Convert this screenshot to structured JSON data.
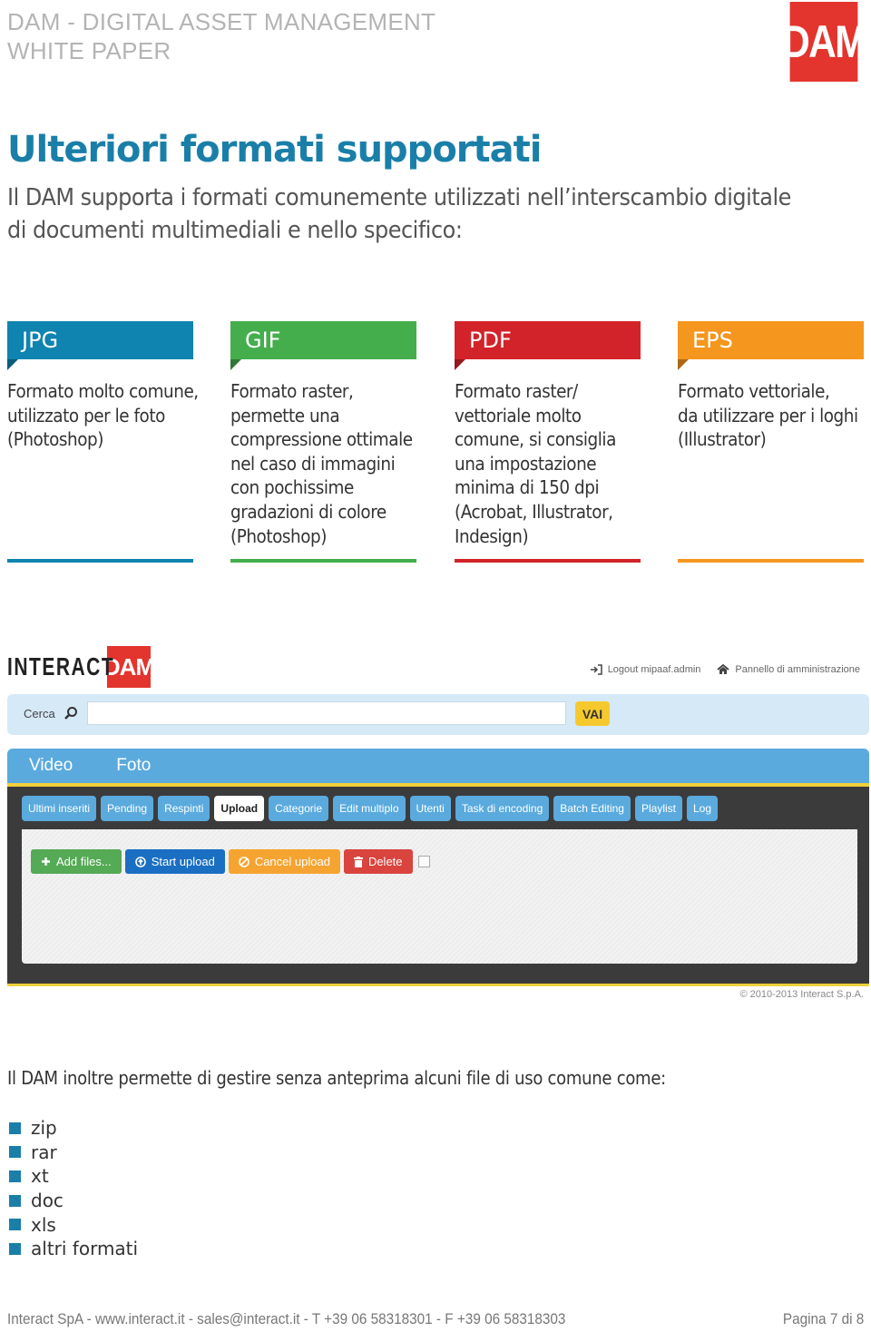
{
  "header": {
    "title_line1": "DAM - DIGITAL ASSET MANAGEMENT",
    "title_line2": "WHITE PAPER",
    "logo": "DAM"
  },
  "section": {
    "title": "Ulteriori formati supportati",
    "intro_lines": [
      "Il DAM supporta i formati comunemente utilizzati nell’interscambio digitale",
      "di documenti multimediali e nello specifico:"
    ]
  },
  "formats": [
    {
      "label": "JPG",
      "color": "#0f84b0",
      "lines": [
        "Formato molto comune,",
        "utilizzato per le foto",
        "(Photoshop)"
      ]
    },
    {
      "label": "GIF",
      "color": "#44ae4c",
      "lines": [
        "Formato raster,",
        "permette una",
        "compressione ottimale",
        "nel caso di immagini",
        "con pochissime",
        "gradazioni di colore",
        "(Photoshop)"
      ]
    },
    {
      "label": "PDF",
      "color": "#d3232a",
      "lines": [
        "Formato raster/",
        "vettoriale molto",
        "comune, si consiglia",
        "una impostazione",
        "minima di 150 dpi",
        "(Acrobat, Illustrator,",
        "Indesign)"
      ]
    },
    {
      "label": "EPS",
      "color": "#f5961e",
      "lines": [
        "Formato vettoriale,",
        "da utilizzare per i loghi",
        "(Illustrator)"
      ]
    }
  ],
  "screenshot": {
    "logo_text": "INTERACT",
    "logo_badge": "DAM",
    "logout_label": "Logout mipaaf.admin",
    "admin_label": "Pannello di amministrazione",
    "search_label": "Cerca",
    "search_value": "",
    "search_button": "VAI",
    "main_tabs": [
      "Video",
      "Foto"
    ],
    "sub_tabs": [
      "Ultimi inseriti",
      "Pending",
      "Respinti",
      "Upload",
      "Categorie",
      "Edit multiplo",
      "Utenti",
      "Task di encoding",
      "Batch Editing",
      "Playlist",
      "Log"
    ],
    "active_sub_tab": "Upload",
    "buttons": {
      "add_files": "Add files...",
      "start_upload": "Start upload",
      "cancel_upload": "Cancel upload",
      "delete": "Delete"
    },
    "copyright": "© 2010-2013 Interact S.p.A."
  },
  "other_files": {
    "intro": "Il DAM inoltre permette di gestire senza anteprima alcuni file di uso comune come:",
    "items": [
      "zip",
      "rar",
      "xt",
      "doc",
      "xls",
      "altri formati"
    ]
  },
  "footer": {
    "contact": "Interact SpA - www.interact.it - sales@interact.it - T +39 06 58318301 - F +39 06 58318303",
    "page": "Pagina 7 di 8"
  }
}
